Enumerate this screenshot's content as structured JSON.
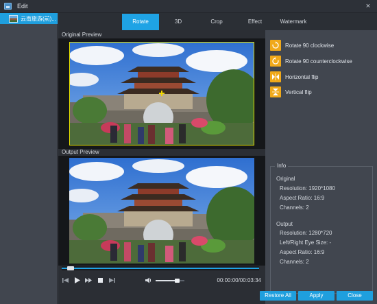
{
  "window": {
    "title": "Edit",
    "close_glyph": "×"
  },
  "file_list": {
    "items": [
      {
        "name": "云南旅游(前)..."
      }
    ]
  },
  "tabs": [
    {
      "label": "Rotate",
      "active": true
    },
    {
      "label": "3D",
      "active": false
    },
    {
      "label": "Crop",
      "active": false
    },
    {
      "label": "Effect",
      "active": false
    },
    {
      "label": "Watermark",
      "active": false
    }
  ],
  "preview": {
    "original_label": "Original Preview",
    "output_label": "Output Preview",
    "progress": 0.03,
    "volume": 0.75,
    "timecode": "00:00:00/00:03:34"
  },
  "rotate_actions": [
    {
      "label": "Rotate 90 clockwise",
      "icon": "rotate-clockwise-icon"
    },
    {
      "label": "Rotate 90 counterclockwise",
      "icon": "rotate-counterclockwise-icon"
    },
    {
      "label": "Horizontal flip",
      "icon": "horizontal-flip-icon"
    },
    {
      "label": "Vertical flip",
      "icon": "vertical-flip-icon"
    }
  ],
  "info": {
    "legend": "Info",
    "original_heading": "Original",
    "original_resolution": "Resolution: 1920*1080",
    "original_aspect": "Aspect Ratio: 16:9",
    "original_channels": "Channels: 2",
    "output_heading": "Output",
    "output_resolution": "Resolution: 1280*720",
    "output_eye": "Left/Right Eye Size: -",
    "output_aspect": "Aspect Ratio: 16:9",
    "output_channels": "Channels: 2"
  },
  "footer": {
    "restore_label": "Restore All",
    "apply_label": "Apply",
    "close_label": "Close"
  },
  "colors": {
    "accent": "#1fa3e5",
    "action_orange": "#f0a91a",
    "frame_yellow": "#e4e000"
  }
}
